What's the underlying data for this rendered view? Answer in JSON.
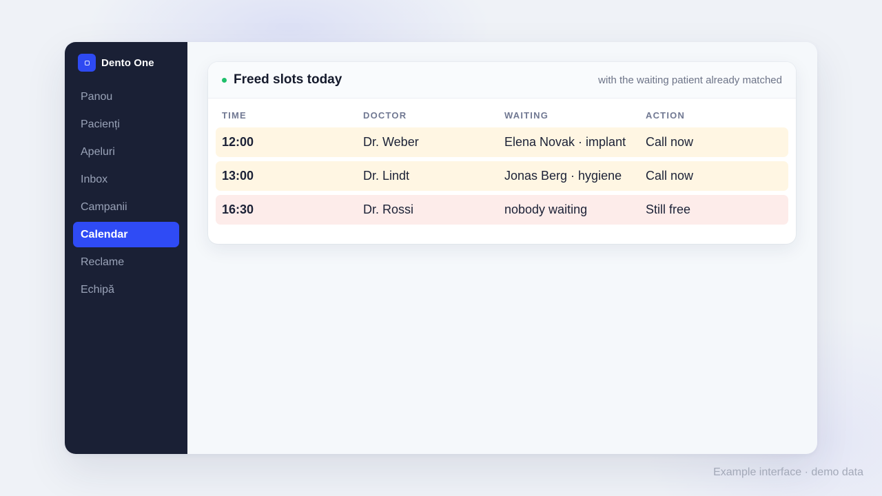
{
  "brand": {
    "name": "Dento One",
    "logo_icon": "square-icon",
    "accent": "#2f4bf5"
  },
  "sidebar": {
    "items": [
      {
        "label": "Panou",
        "active": false
      },
      {
        "label": "Pacienți",
        "active": false
      },
      {
        "label": "Apeluri",
        "active": false
      },
      {
        "label": "Inbox",
        "active": false
      },
      {
        "label": "Campanii",
        "active": false
      },
      {
        "label": "Calendar",
        "active": true
      },
      {
        "label": "Reclame",
        "active": false
      },
      {
        "label": "Echipă",
        "active": false
      }
    ]
  },
  "card": {
    "title": "Freed slots today",
    "subtitle": "with the waiting patient already matched",
    "status_dot_color": "#1fbf6b",
    "columns": [
      "TIME",
      "DOCTOR",
      "WAITING",
      "ACTION"
    ],
    "rows": [
      {
        "time": "12:00",
        "doctor": "Dr. Weber",
        "waiting": "Elena Novak · implant",
        "action": "Call now",
        "tone": "warn"
      },
      {
        "time": "13:00",
        "doctor": "Dr. Lindt",
        "waiting": "Jonas Berg · hygiene",
        "action": "Call now",
        "tone": "warn"
      },
      {
        "time": "16:30",
        "doctor": "Dr. Rossi",
        "waiting": "nobody waiting",
        "action": "Still free",
        "tone": "danger"
      }
    ]
  },
  "footer": {
    "note": "Example interface · demo data"
  }
}
